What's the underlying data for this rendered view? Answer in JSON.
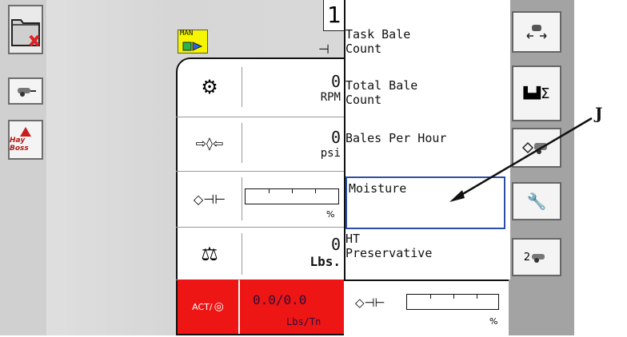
{
  "indicator": {
    "mode": "MAN",
    "number": "1"
  },
  "left_buttons": [
    "Hay Boss"
  ],
  "right_buttons": [
    "2"
  ],
  "readings": [
    {
      "name": "rpm",
      "value": "0",
      "unit": "RPM"
    },
    {
      "name": "pressure",
      "value": "0",
      "unit": "psi"
    },
    {
      "name": "moisture",
      "unit": "%",
      "level": 0
    },
    {
      "name": "weight",
      "value": "0",
      "unit": "Lbs."
    }
  ],
  "menu": [
    {
      "label_l1": "Task Bale",
      "label_l2": "Count"
    },
    {
      "label_l1": "Total Bale",
      "label_l2": "Count"
    },
    {
      "label_l1": "Bales Per Hour",
      "label_l2": ""
    },
    {
      "label_l1": "Moisture",
      "label_l2": ""
    },
    {
      "label_l1": "HT",
      "label_l2": "Preservative"
    }
  ],
  "actuator": {
    "label": "ACT/",
    "value": "0.0/0.0",
    "unit": "Lbs/Tn"
  },
  "bottom_bar_unit": "%",
  "callout": {
    "letter": "J"
  },
  "colors": {
    "alarm_red": "#ee1515",
    "selection_blue": "#2b4ea6",
    "man_yellow": "#f5f500"
  }
}
